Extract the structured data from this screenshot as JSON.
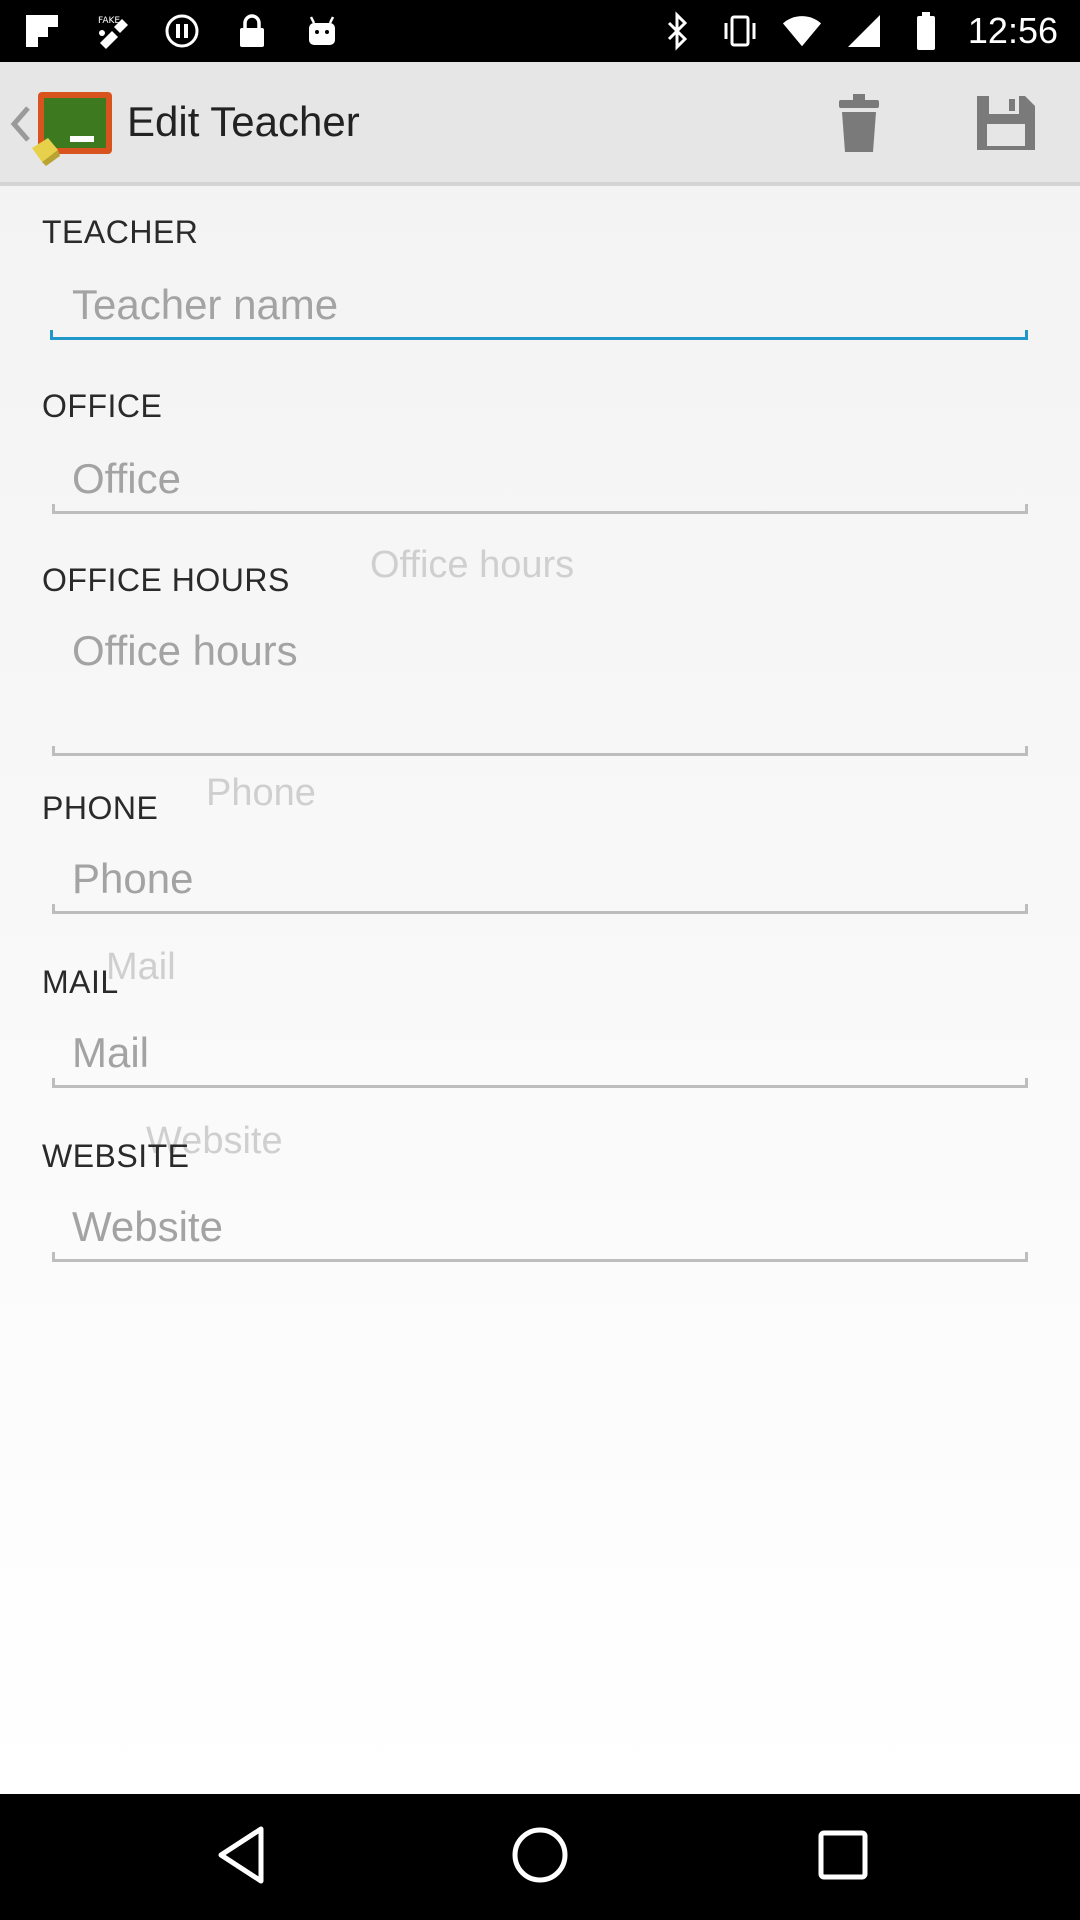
{
  "status_bar": {
    "time": "12:56",
    "left_icons": [
      "flipboard-icon",
      "fake-gps-icon",
      "sync-icon",
      "lock-icon",
      "android-icon"
    ],
    "right_icons": [
      "bluetooth-icon",
      "vibrate-icon",
      "wifi-icon",
      "signal-icon",
      "battery-icon"
    ]
  },
  "app_bar": {
    "title": "Edit Teacher",
    "icons": [
      "back-arrow-icon",
      "chalkboard-logo-icon",
      "trash-icon",
      "save-floppy-icon"
    ]
  },
  "form": {
    "teacher": {
      "label": "TEACHER",
      "placeholder": "Teacher name",
      "value": ""
    },
    "office": {
      "label": "OFFICE",
      "placeholder": "Office",
      "value": ""
    },
    "office_hours": {
      "label": "OFFICE HOURS",
      "floating_hint": "Office hours",
      "placeholder": "Office hours",
      "value": ""
    },
    "phone": {
      "label": "PHONE",
      "floating_hint": "Phone",
      "placeholder": "Phone",
      "value": ""
    },
    "mail": {
      "label": "MAIL",
      "floating_hint": "Mail",
      "placeholder": "Mail",
      "value": ""
    },
    "website": {
      "label": "WEBSITE",
      "floating_hint": "Website",
      "placeholder": "Website",
      "value": ""
    }
  },
  "nav_bar": {
    "icons": [
      "back-triangle-icon",
      "home-circle-icon",
      "recents-square-icon"
    ]
  },
  "colors": {
    "active_underline": "#2196c9",
    "app_bar_bg": "#e6e6e6",
    "status_bar_bg": "#000000"
  }
}
